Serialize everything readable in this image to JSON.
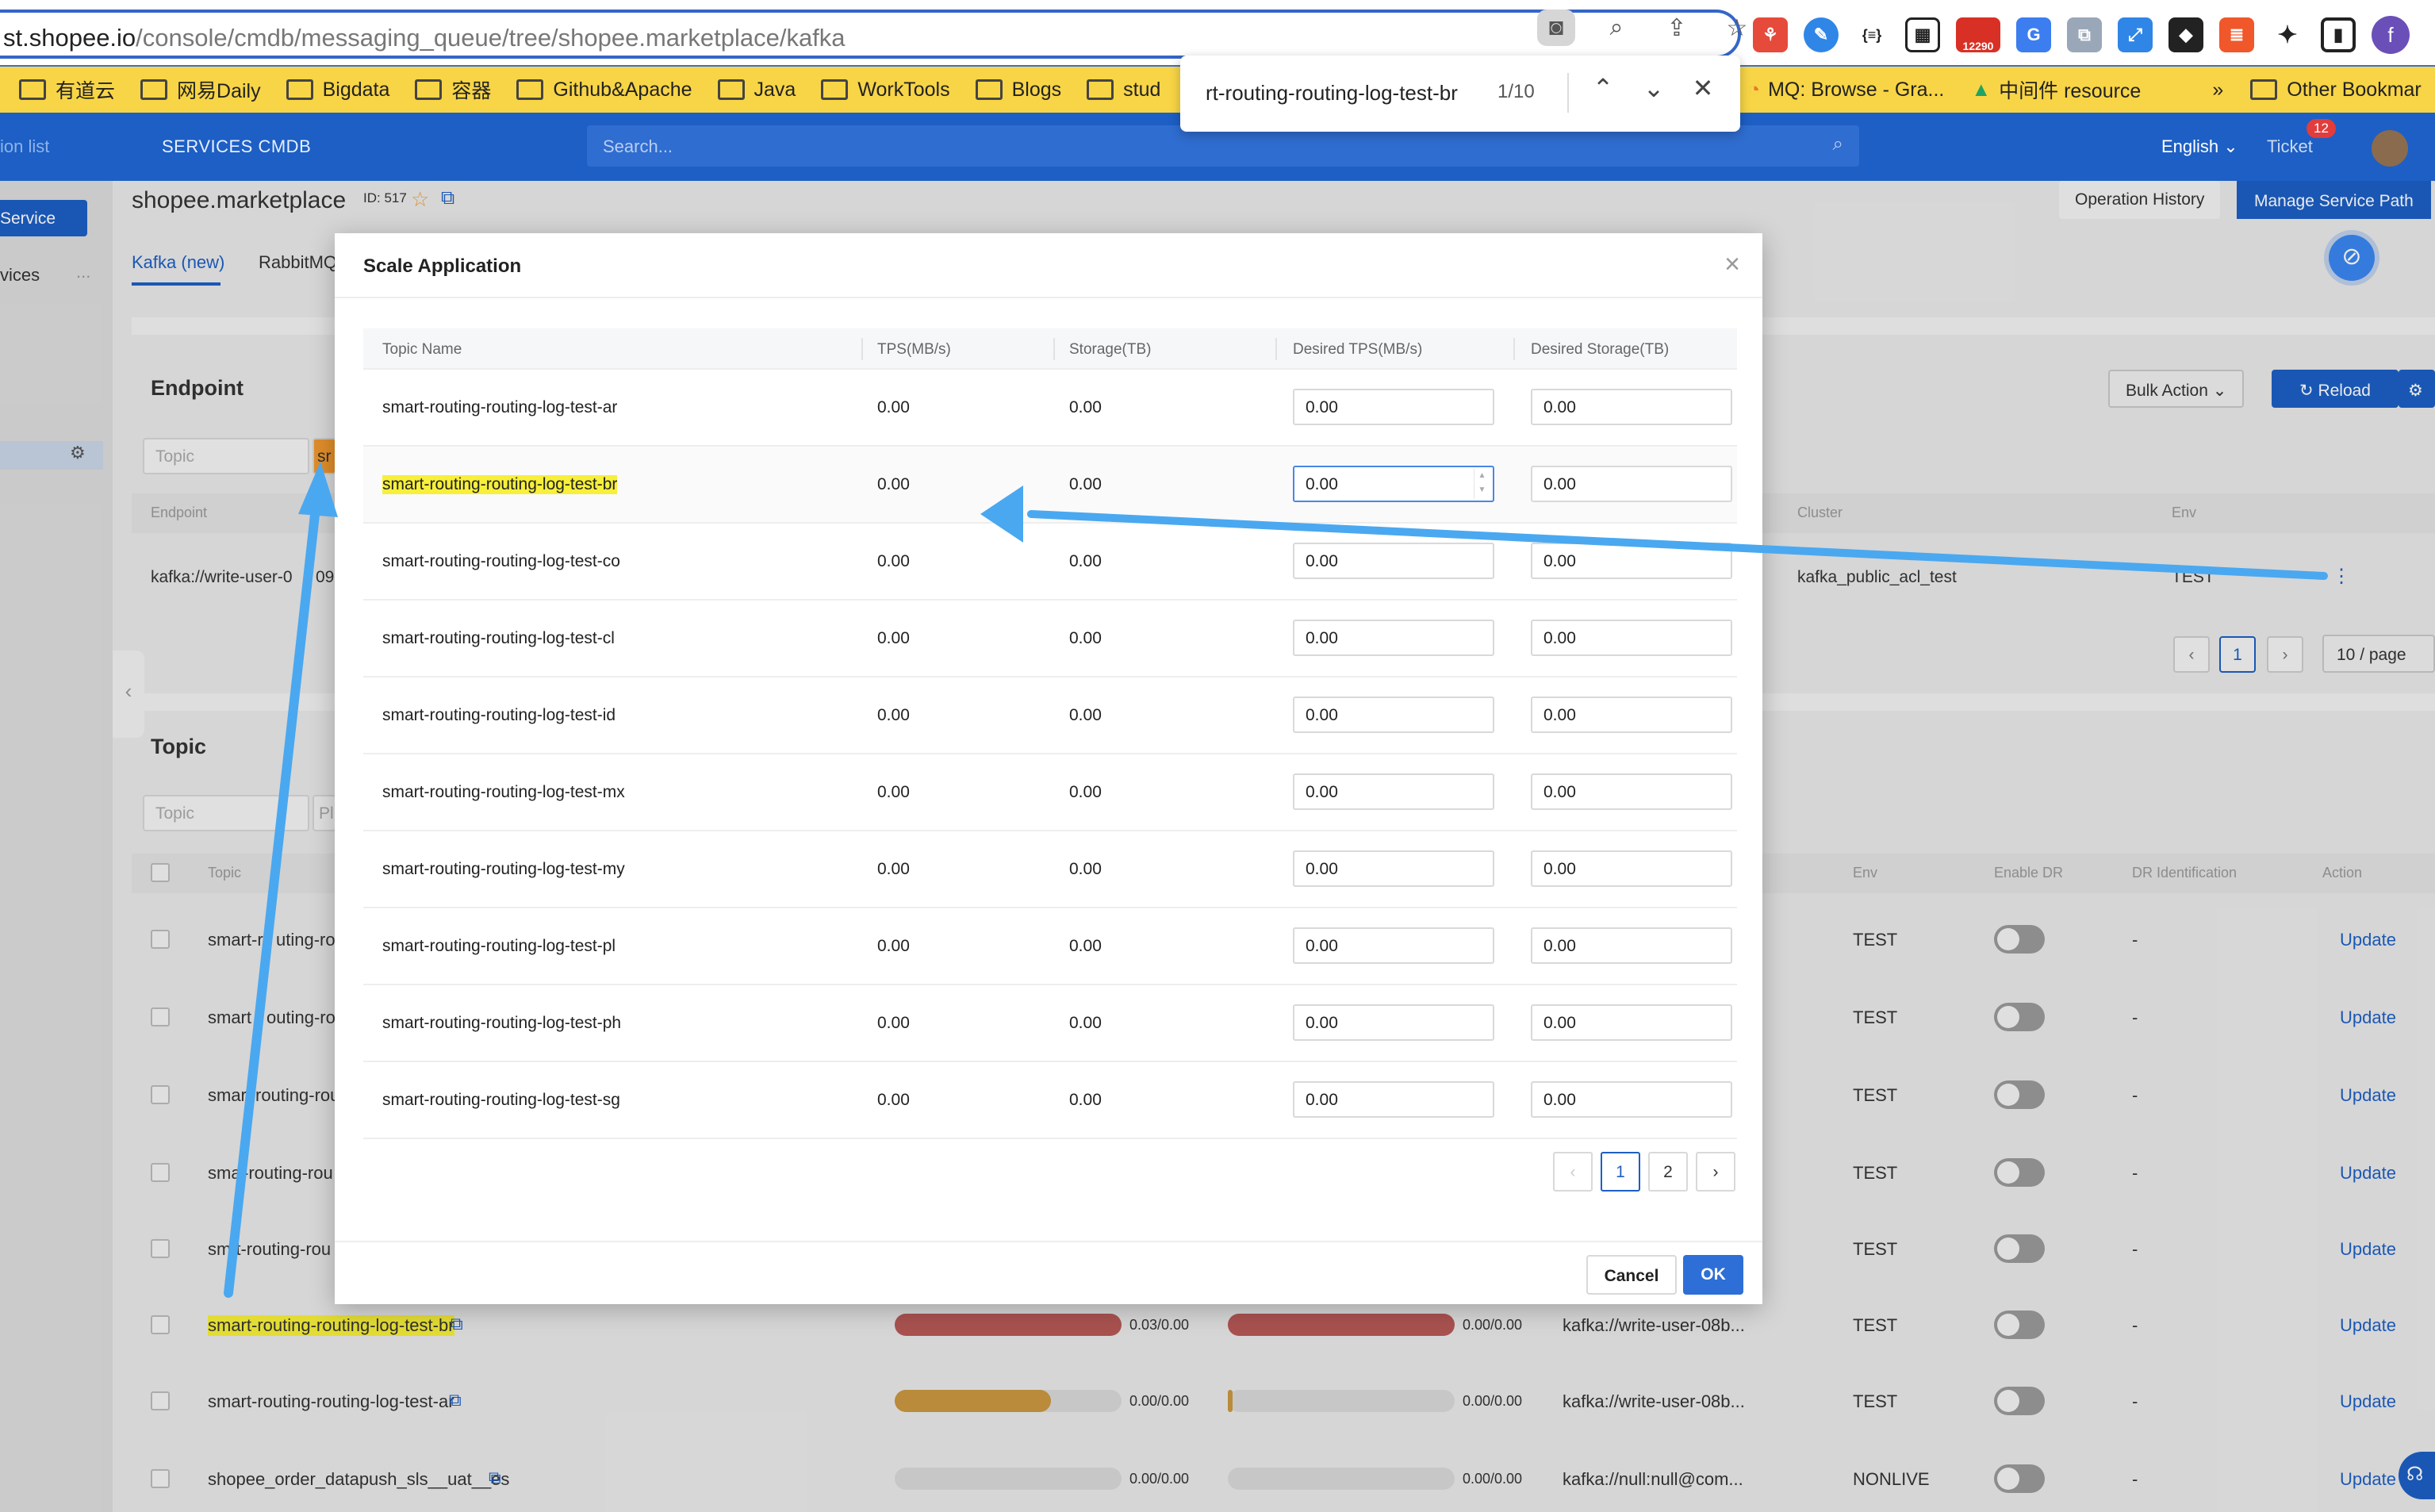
{
  "browser": {
    "url_host": "st.shopee.io",
    "url_path": "/console/cmdb/messaging_queue/tree/shopee.marketplace/kafka",
    "bookmarks": [
      "有道云",
      "网易Daily",
      "Bigdata",
      "容器",
      "Github&Apache",
      "Java",
      "WorkTools",
      "Blogs",
      "stud"
    ],
    "bookmarks_right": [
      "MQ: Browse - Gra...",
      "中间件 resource"
    ],
    "more_label": "»",
    "other_bookmarks": "Other Bookmar",
    "ext_badge": "12290",
    "profile_initial": "f"
  },
  "find": {
    "query": "rt-routing-routing-log-test-br",
    "count": "1/10"
  },
  "appbar": {
    "crumb": "ion list",
    "title": "SERVICES CMDB",
    "search_placeholder": "Search...",
    "language": "English",
    "ticket": "Ticket",
    "ticket_count": "12"
  },
  "page": {
    "service_button": "Service",
    "side_tab": "vices",
    "side_more": "...",
    "service_name": "shopee.marketplace",
    "service_id": "ID: 517",
    "tabs": [
      "Kafka (new)",
      "RabbitMQ"
    ],
    "operation_history": "Operation History",
    "manage_service_path": "Manage Service Path",
    "endpoint_title": "Endpoint",
    "topic_placeholder": "Topic",
    "endpoint_highlight": "sr",
    "bulk_action": "Bulk Action",
    "reload": "Reload",
    "endpoint_cols": {
      "endpoint": "Endpoint",
      "cluster": "Cluster",
      "env": "Env"
    },
    "endpoint_row": {
      "endpoint": "kafka://write-user-0",
      "endpoint_tail": "09",
      "cluster": "kafka_public_acl_test",
      "env": "TEST"
    },
    "pager": {
      "page": "1",
      "per_page": "10 / page"
    },
    "topic_title": "Topic",
    "topic_filter2": "Pl",
    "topic_cols": {
      "topic": "Topic",
      "env": "Env",
      "enable_dr": "Enable DR",
      "dr_id": "DR Identification",
      "action": "Action"
    },
    "topic_rows": [
      {
        "topic": "smart-r",
        "topic_tail": "uting-rou",
        "env": "TEST",
        "dr": "-",
        "action": "Update"
      },
      {
        "topic": "smart",
        "topic_tail": "outing-rou",
        "env": "TEST",
        "dr": "-",
        "action": "Update"
      },
      {
        "topic": "smar",
        "topic_tail": "routing-rou",
        "env": "TEST",
        "dr": "-",
        "action": "Update"
      },
      {
        "topic": "sma",
        "topic_tail": "-routing-rou",
        "env": "TEST",
        "dr": "-",
        "action": "Update"
      },
      {
        "topic": "sm",
        "topic_tail": "rt-routing-rou",
        "env": "TEST",
        "dr": "-",
        "action": "Update"
      },
      {
        "topic": "smart-routing-routing-log-test-br",
        "tps": "0.03/0.00",
        "storage": "0.00/0.00",
        "endpoint": "kafka://write-user-08b...",
        "env": "TEST",
        "dr": "-",
        "action": "Update"
      },
      {
        "topic": "smart-routing-routing-log-test-ar",
        "tps": "0.00/0.00",
        "storage": "0.00/0.00",
        "endpoint": "kafka://write-user-08b...",
        "env": "TEST",
        "dr": "-",
        "action": "Update"
      },
      {
        "topic": "shopee_order_datapush_sls__uat__es",
        "tps": "0.00/0.00",
        "storage": "0.00/0.00",
        "endpoint": "kafka://null:null@com...",
        "env": "NONLIVE",
        "dr": "-",
        "action": "Update"
      }
    ],
    "usage_bars": [
      {
        "tps": 1.0,
        "storage": 1.0,
        "tps_color": "#b85a57",
        "storage_color": "#b85a57"
      },
      {
        "tps": 0.69,
        "storage": 0.02,
        "tps_color": "#c9973f",
        "storage_color": "#c9973f"
      },
      {
        "tps": 0,
        "storage": 0,
        "tps_color": "#d8d8d8",
        "storage_color": "#d8d8d8"
      }
    ]
  },
  "modal": {
    "title": "Scale Application",
    "columns": [
      "Topic Name",
      "TPS(MB/s)",
      "Storage(TB)",
      "Desired TPS(MB/s)",
      "Desired Storage(TB)"
    ],
    "rows": [
      {
        "name": "smart-routing-routing-log-test-ar",
        "tps": "0.00",
        "storage": "0.00",
        "desired_tps": "0.00",
        "desired_storage": "0.00"
      },
      {
        "name": "smart-routing-routing-log-test-br",
        "tps": "0.00",
        "storage": "0.00",
        "desired_tps": "0.00",
        "desired_storage": "0.00"
      },
      {
        "name": "smart-routing-routing-log-test-co",
        "tps": "0.00",
        "storage": "0.00",
        "desired_tps": "0.00",
        "desired_storage": "0.00"
      },
      {
        "name": "smart-routing-routing-log-test-cl",
        "tps": "0.00",
        "storage": "0.00",
        "desired_tps": "0.00",
        "desired_storage": "0.00"
      },
      {
        "name": "smart-routing-routing-log-test-id",
        "tps": "0.00",
        "storage": "0.00",
        "desired_tps": "0.00",
        "desired_storage": "0.00"
      },
      {
        "name": "smart-routing-routing-log-test-mx",
        "tps": "0.00",
        "storage": "0.00",
        "desired_tps": "0.00",
        "desired_storage": "0.00"
      },
      {
        "name": "smart-routing-routing-log-test-my",
        "tps": "0.00",
        "storage": "0.00",
        "desired_tps": "0.00",
        "desired_storage": "0.00"
      },
      {
        "name": "smart-routing-routing-log-test-pl",
        "tps": "0.00",
        "storage": "0.00",
        "desired_tps": "0.00",
        "desired_storage": "0.00"
      },
      {
        "name": "smart-routing-routing-log-test-ph",
        "tps": "0.00",
        "storage": "0.00",
        "desired_tps": "0.00",
        "desired_storage": "0.00"
      },
      {
        "name": "smart-routing-routing-log-test-sg",
        "tps": "0.00",
        "storage": "0.00",
        "desired_tps": "0.00",
        "desired_storage": "0.00"
      }
    ],
    "pagination": {
      "page1": "1",
      "page2": "2"
    },
    "cancel": "Cancel",
    "ok": "OK"
  },
  "colors": {
    "accent": "#1d5fc4",
    "highlight": "#f7ef3a",
    "annotation_arrow": "#4aa8f0",
    "bookmark_bar": "#f8d546"
  }
}
